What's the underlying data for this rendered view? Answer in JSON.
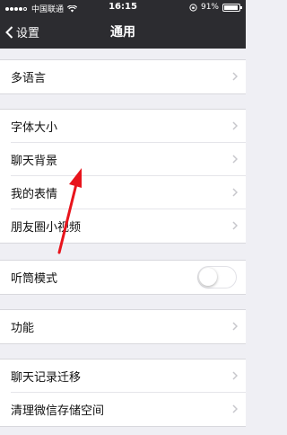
{
  "status_bar": {
    "carrier": "中国联通",
    "time": "16:15",
    "battery": "91%",
    "battery_level": 0.91,
    "signal_bars": 4
  },
  "nav": {
    "back_label": "设置",
    "title": "通用"
  },
  "groups": [
    {
      "items": [
        {
          "label": "多语言"
        }
      ]
    },
    {
      "items": [
        {
          "label": "字体大小"
        },
        {
          "label": "聊天背景"
        },
        {
          "label": "我的表情"
        },
        {
          "label": "朋友圈小视频"
        }
      ]
    },
    {
      "items": [
        {
          "label": "听筒模式",
          "toggle": false
        }
      ]
    },
    {
      "items": [
        {
          "label": "功能"
        }
      ]
    },
    {
      "items": [
        {
          "label": "聊天记录迁移"
        },
        {
          "label": "清理微信存储空间"
        }
      ]
    }
  ],
  "colors": {
    "navbar": "#2c2c30",
    "background": "#efeff4",
    "annotation_arrow": "#e8141c"
  }
}
